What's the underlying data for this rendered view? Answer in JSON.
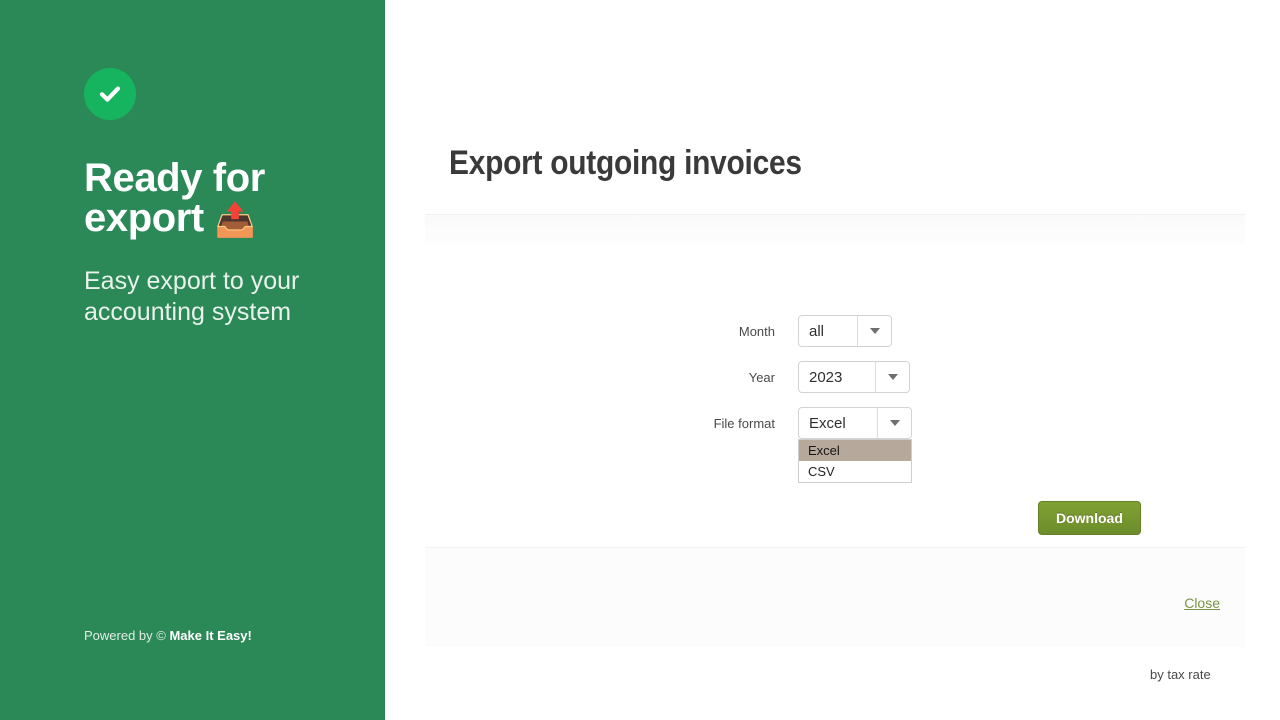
{
  "sidebar": {
    "status_icon": "check-circle-icon",
    "title": "Ready for",
    "title_line2": "export",
    "title_emoji": "📤",
    "subtitle": "Easy export to your accounting system",
    "footer_prefix": "Powered by ©",
    "footer_brand": "Make It Easy!",
    "colors": {
      "background": "#2b8857",
      "badge": "#17b45f",
      "title": "#ffffff",
      "subtitle": "#e9f2ec"
    }
  },
  "main": {
    "page_title": "Export outgoing invoices",
    "form": {
      "rows": [
        {
          "label": "Month",
          "value": "all"
        },
        {
          "label": "Year",
          "value": "2023"
        },
        {
          "label": "File format",
          "value": "Excel"
        }
      ],
      "file_format_options": [
        {
          "label": "Excel",
          "selected": true
        },
        {
          "label": "CSV",
          "selected": false
        }
      ],
      "tax_note": "by tax rate",
      "download_label": "Download"
    },
    "footer": {
      "close_label": "Close"
    },
    "colors": {
      "title": "#3a3a3a",
      "download_button": "#7fa233",
      "close_link": "#7b9445",
      "option_highlight": "#b6a89b"
    }
  }
}
